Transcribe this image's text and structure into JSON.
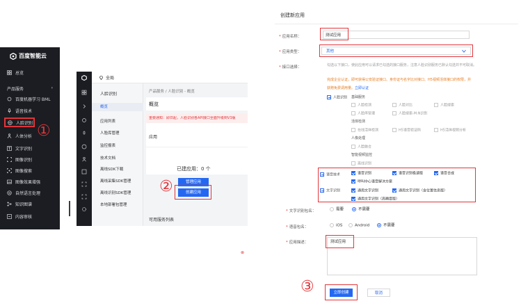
{
  "step_marks": {
    "one": "①",
    "two": "②",
    "three": "③"
  },
  "colors": {
    "accent": "#2468f2",
    "highlight": "#e1353a",
    "sidebar": "#1b1d22"
  },
  "panel1": {
    "logo_text": "百度智能云",
    "overview": "总览",
    "section_label": "产品服务",
    "items": [
      {
        "icon": "chip-icon",
        "label": "百度机器学习 BML"
      },
      {
        "icon": "mic-icon",
        "label": "语音技术"
      },
      {
        "icon": "face-icon",
        "label": "人脸识别"
      },
      {
        "icon": "person-icon",
        "label": "人体分析"
      },
      {
        "icon": "text-icon",
        "label": "文字识别"
      },
      {
        "icon": "image-icon",
        "label": "图像识别"
      },
      {
        "icon": "image-search-icon",
        "label": "图像搜索"
      },
      {
        "icon": "image-enhance-icon",
        "label": "图像效果增强"
      },
      {
        "icon": "nlp-icon",
        "label": "自然语言处理"
      },
      {
        "icon": "kg-icon",
        "label": "知识图谱"
      },
      {
        "icon": "audit-icon",
        "label": "内容审核"
      }
    ]
  },
  "panel2": {
    "region": "全局",
    "nav_title": "人脸识别",
    "nav_items": [
      "概览",
      "应用列表",
      "人脸库管理",
      "监控报表",
      "技术文档",
      "离线SDK下载",
      "离线采集SDK管理",
      "离线识别SDK管理",
      "本地部署包管理"
    ],
    "breadcrumb": "产品服务 / 人脸识别 - 概览",
    "page_title": "概览",
    "notice": "重要通知：即日起，人脸识别各API接口全面升级到V3版",
    "section_apps": "应用",
    "created_label": "已建应用：",
    "created_count": "0 个",
    "manage_btn": "管理应用",
    "create_btn": "创建应用",
    "services_label": "可用服务列表"
  },
  "panel3": {
    "title": "创建新应用",
    "name_label": "应用名称：",
    "name_value": "测试应用",
    "type_label": "应用类型：",
    "type_value": "其他",
    "api_label": "接口选择：",
    "api_desc": "勾选以下接口，使此应用可以请求已勾选的接口服务，注意人脸识别服务已默认勾选并不可取消。",
    "api_warn1": "完成企业认证，即可获得公安验证接口、身份证与名字比对接口、H5视频活体接口的权限，并",
    "api_warn2": "获赠免费调用量。",
    "api_link": "立即认证",
    "face_group": "人脸识别",
    "basic_head": "基础服务",
    "basic_items": [
      "人脸检测",
      "人脸对比",
      "人脸搜索",
      "人脸库管理",
      "人脸搜索-M:N识别"
    ],
    "live_head": "活体检测",
    "live_items": [
      "在线活体检测",
      "H5语音验证码",
      "H5活体视频分析"
    ],
    "body_head": "人像处理",
    "body_items": [
      "人脸融合"
    ],
    "smart_head": "智能视频监控",
    "smart_items": [
      "离线识别"
    ],
    "voice_group": "语音技术",
    "voice_items": [
      "语音识别",
      "语音识别极速版",
      "语音合成",
      "呼叫中心语音解决方案"
    ],
    "ocr_group": "文字识别",
    "ocr_items": [
      "通用文字识别",
      "通用文字识别（含位置信息版）",
      "通用文字识别（高精度版）"
    ],
    "pkg_label": "文字识别包名：",
    "pkg_opts": [
      "需要",
      "不需要"
    ],
    "voice_pkg_label": "语音包名：",
    "voice_pkg_opts": [
      "iOS",
      "Android",
      "不需要"
    ],
    "desc_label": "应用描述：",
    "desc_value": "测试应用",
    "submit": "立即创建",
    "cancel": "取消"
  }
}
